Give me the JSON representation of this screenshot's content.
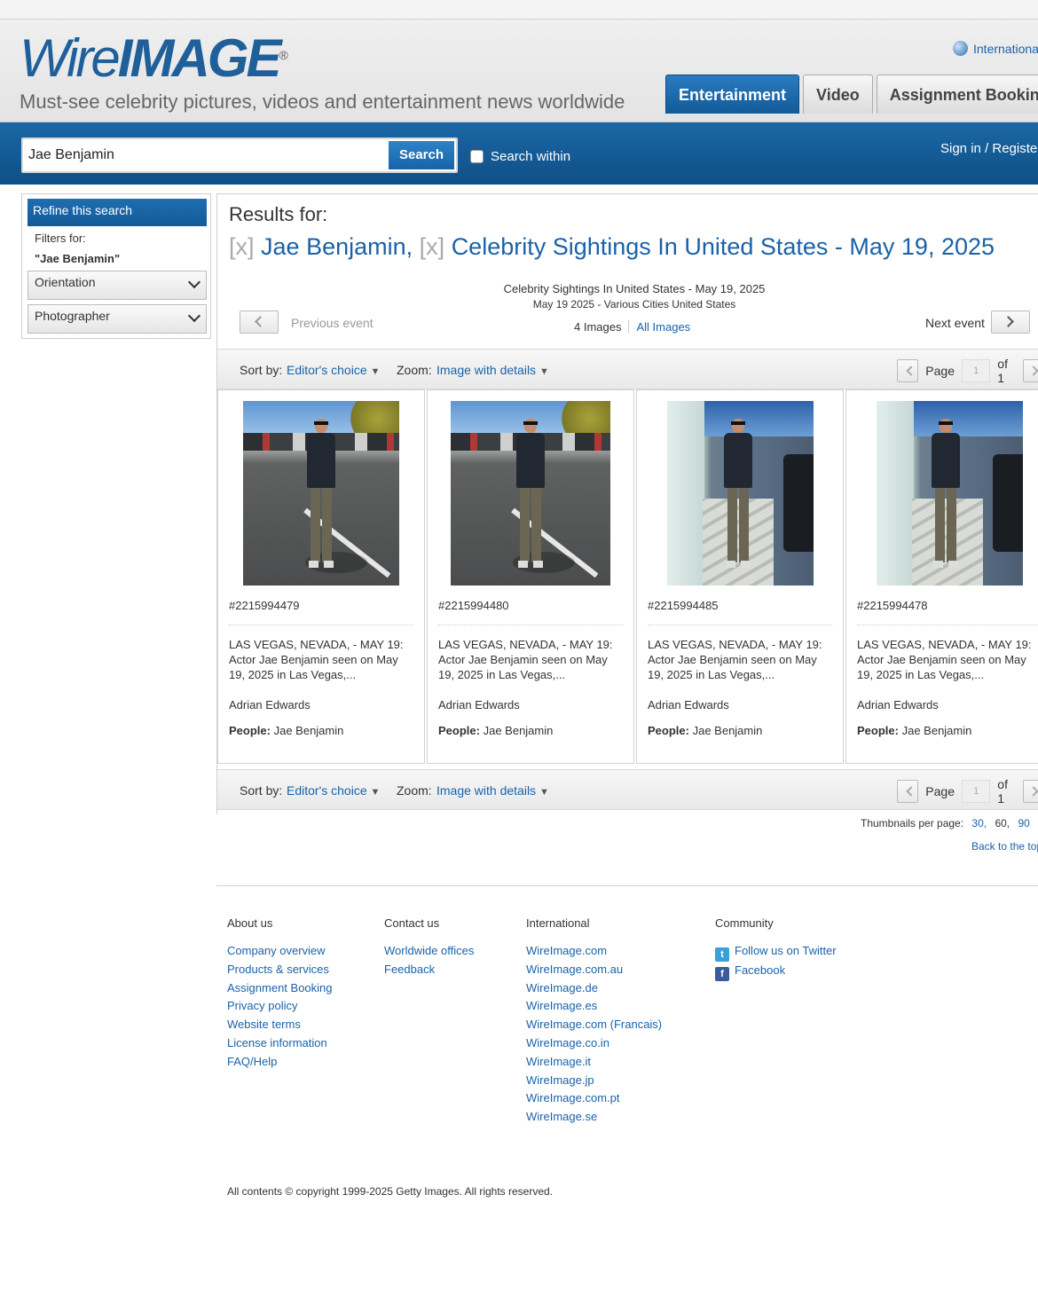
{
  "header": {
    "logo_text_light": "Wire",
    "logo_text_bold": "IMAGE",
    "logo_reg": "®",
    "tagline": "Must-see celebrity pictures, videos and entertainment news worldwide",
    "international": "International",
    "tabs": [
      {
        "label": "Entertainment",
        "active": true
      },
      {
        "label": "Video",
        "active": false
      },
      {
        "label": "Assignment Booking",
        "active": false
      }
    ]
  },
  "search": {
    "value": "Jae Benjamin",
    "button": "Search",
    "within_label": "Search within",
    "within_checked": false,
    "signin": "Sign in / Register"
  },
  "refine": {
    "title": "Refine this search",
    "filters_label": "Filters for:",
    "filter_value": "\"Jae Benjamin\"",
    "dropdowns": [
      "Orientation",
      "Photographer"
    ]
  },
  "results": {
    "label": "Results for:",
    "remove_mark": "[x]",
    "terms": [
      "Jae Benjamin,",
      "Celebrity Sightings In United States - May 19, 2025"
    ],
    "event_title": "Celebrity Sightings In United States - May 19, 2025",
    "event_subtitle": "May 19 2025 - Various Cities United States",
    "prev_event": "Previous event",
    "next_event": "Next event",
    "image_count": "4 Images",
    "all_images": "All Images"
  },
  "toolbar": {
    "sort_label": "Sort by:",
    "sort_value": "Editor's choice",
    "zoom_label": "Zoom:",
    "zoom_value": "Image with details",
    "page_label": "Page",
    "page_current": "1",
    "page_of": "of 1"
  },
  "cards": [
    {
      "id": "#2215994479",
      "caption": "LAS VEGAS, NEVADA, - MAY 19: Actor Jae Benjamin seen on May 19, 2025 in Las Vegas,...",
      "photographer": "Adrian Edwards",
      "people_label": "People:",
      "people": "Jae Benjamin"
    },
    {
      "id": "#2215994480",
      "caption": "LAS VEGAS, NEVADA, - MAY 19: Actor Jae Benjamin seen on May 19, 2025 in Las Vegas,...",
      "photographer": "Adrian Edwards",
      "people_label": "People:",
      "people": "Jae Benjamin"
    },
    {
      "id": "#2215994485",
      "caption": "LAS VEGAS, NEVADA, - MAY 19: Actor Jae Benjamin seen on May 19, 2025 in Las Vegas,...",
      "photographer": "Adrian Edwards",
      "people_label": "People:",
      "people": "Jae Benjamin"
    },
    {
      "id": "#2215994478",
      "caption": "LAS VEGAS, NEVADA, - MAY 19: Actor Jae Benjamin seen on May 19, 2025 in Las Vegas,...",
      "photographer": "Adrian Edwards",
      "people_label": "People:",
      "people": "Jae Benjamin"
    }
  ],
  "thumbs_per_page": {
    "label": "Thumbnails per page:",
    "options": [
      "30,",
      "60,",
      "90"
    ]
  },
  "back_to_top": "Back to the top",
  "footer": {
    "about": {
      "heading": "About us",
      "links": [
        "Company overview",
        "Products & services",
        "Assignment Booking",
        "Privacy policy",
        "Website terms",
        "License information",
        "FAQ/Help"
      ]
    },
    "contact": {
      "heading": "Contact us",
      "links": [
        "Worldwide offices",
        "Feedback"
      ]
    },
    "international": {
      "heading": "International",
      "links": [
        "WireImage.com",
        "WireImage.com.au",
        "WireImage.de",
        "WireImage.es",
        "WireImage.com (Francais)",
        "WireImage.co.in",
        "WireImage.it",
        "WireImage.jp",
        "WireImage.com.pt",
        "WireImage.se"
      ]
    },
    "community": {
      "heading": "Community",
      "links": [
        "Follow us on Twitter",
        "Facebook"
      ]
    },
    "copyright": "All contents © copyright 1999-2025 Getty Images. All rights reserved."
  },
  "colors": {
    "brand_blue": "#1f5f9a",
    "link": "#1a62a8",
    "search_bar": "#0f4f86"
  }
}
